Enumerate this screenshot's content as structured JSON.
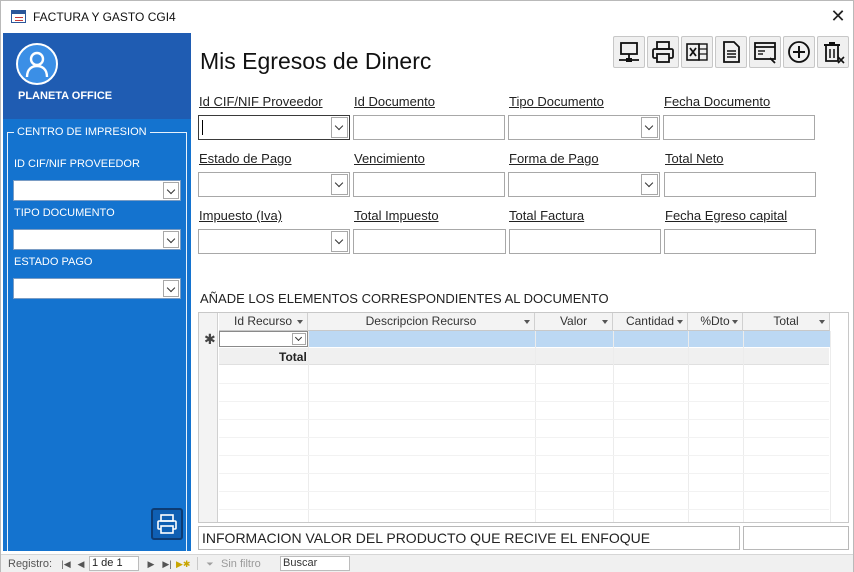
{
  "window": {
    "title": "FACTURA Y GASTO CGI4",
    "close_glyph": "✕"
  },
  "sidebar": {
    "brand": "PLANETA OFFICE",
    "group_title": "CENTRO DE IMPRESION",
    "filters": [
      {
        "label": "ID CIF/NIF PROVEEDOR",
        "value": ""
      },
      {
        "label": "TIPO DOCUMENTO",
        "value": ""
      },
      {
        "label": "ESTADO PAGO",
        "value": ""
      }
    ],
    "accent_color": "#1473cf",
    "head_color": "#1f5cb2"
  },
  "form": {
    "title": "Mis Egresos de Dinerc",
    "toolbar": [
      "network-icon",
      "print-icon",
      "excel-icon",
      "document-icon",
      "window-search-icon",
      "add-circle-icon",
      "delete-icon"
    ],
    "fields": [
      {
        "label": "Id CIF/NIF Proveedor",
        "value": "",
        "type": "combo"
      },
      {
        "label": "Id Documento",
        "value": "",
        "type": "text"
      },
      {
        "label": "Tipo Documento",
        "value": "",
        "type": "combo"
      },
      {
        "label": "Fecha Documento",
        "value": "",
        "type": "text"
      },
      {
        "label": "Estado de Pago",
        "value": "",
        "type": "combo"
      },
      {
        "label": "Vencimiento",
        "value": "",
        "type": "text"
      },
      {
        "label": "Forma de Pago",
        "value": "",
        "type": "combo"
      },
      {
        "label": "Total Neto",
        "value": "",
        "type": "text"
      },
      {
        "label": "Impuesto (Iva)",
        "value": "",
        "type": "combo"
      },
      {
        "label": "Total Impuesto",
        "value": "",
        "type": "text"
      },
      {
        "label": "Total Factura",
        "value": "",
        "type": "text"
      },
      {
        "label": "Fecha Egreso capital",
        "value": "",
        "type": "text"
      }
    ]
  },
  "details": {
    "section_title": "AÑADE LOS ELEMENTOS CORRESPONDIENTES AL DOCUMENTO",
    "columns": [
      "Id Recurso",
      "Descripcion Recurso",
      "Valor",
      "Cantidad",
      "%Dto",
      "Total"
    ],
    "new_row_marker": "✱",
    "total_label": "Total"
  },
  "info": {
    "text": "INFORMACION VALOR DEL PRODUCTO QUE RECIVE EL ENFOQUE",
    "value": ""
  },
  "navigation": {
    "label": "Registro:",
    "position": "1 de 1",
    "filter": "Sin filtro",
    "search": "Buscar"
  }
}
